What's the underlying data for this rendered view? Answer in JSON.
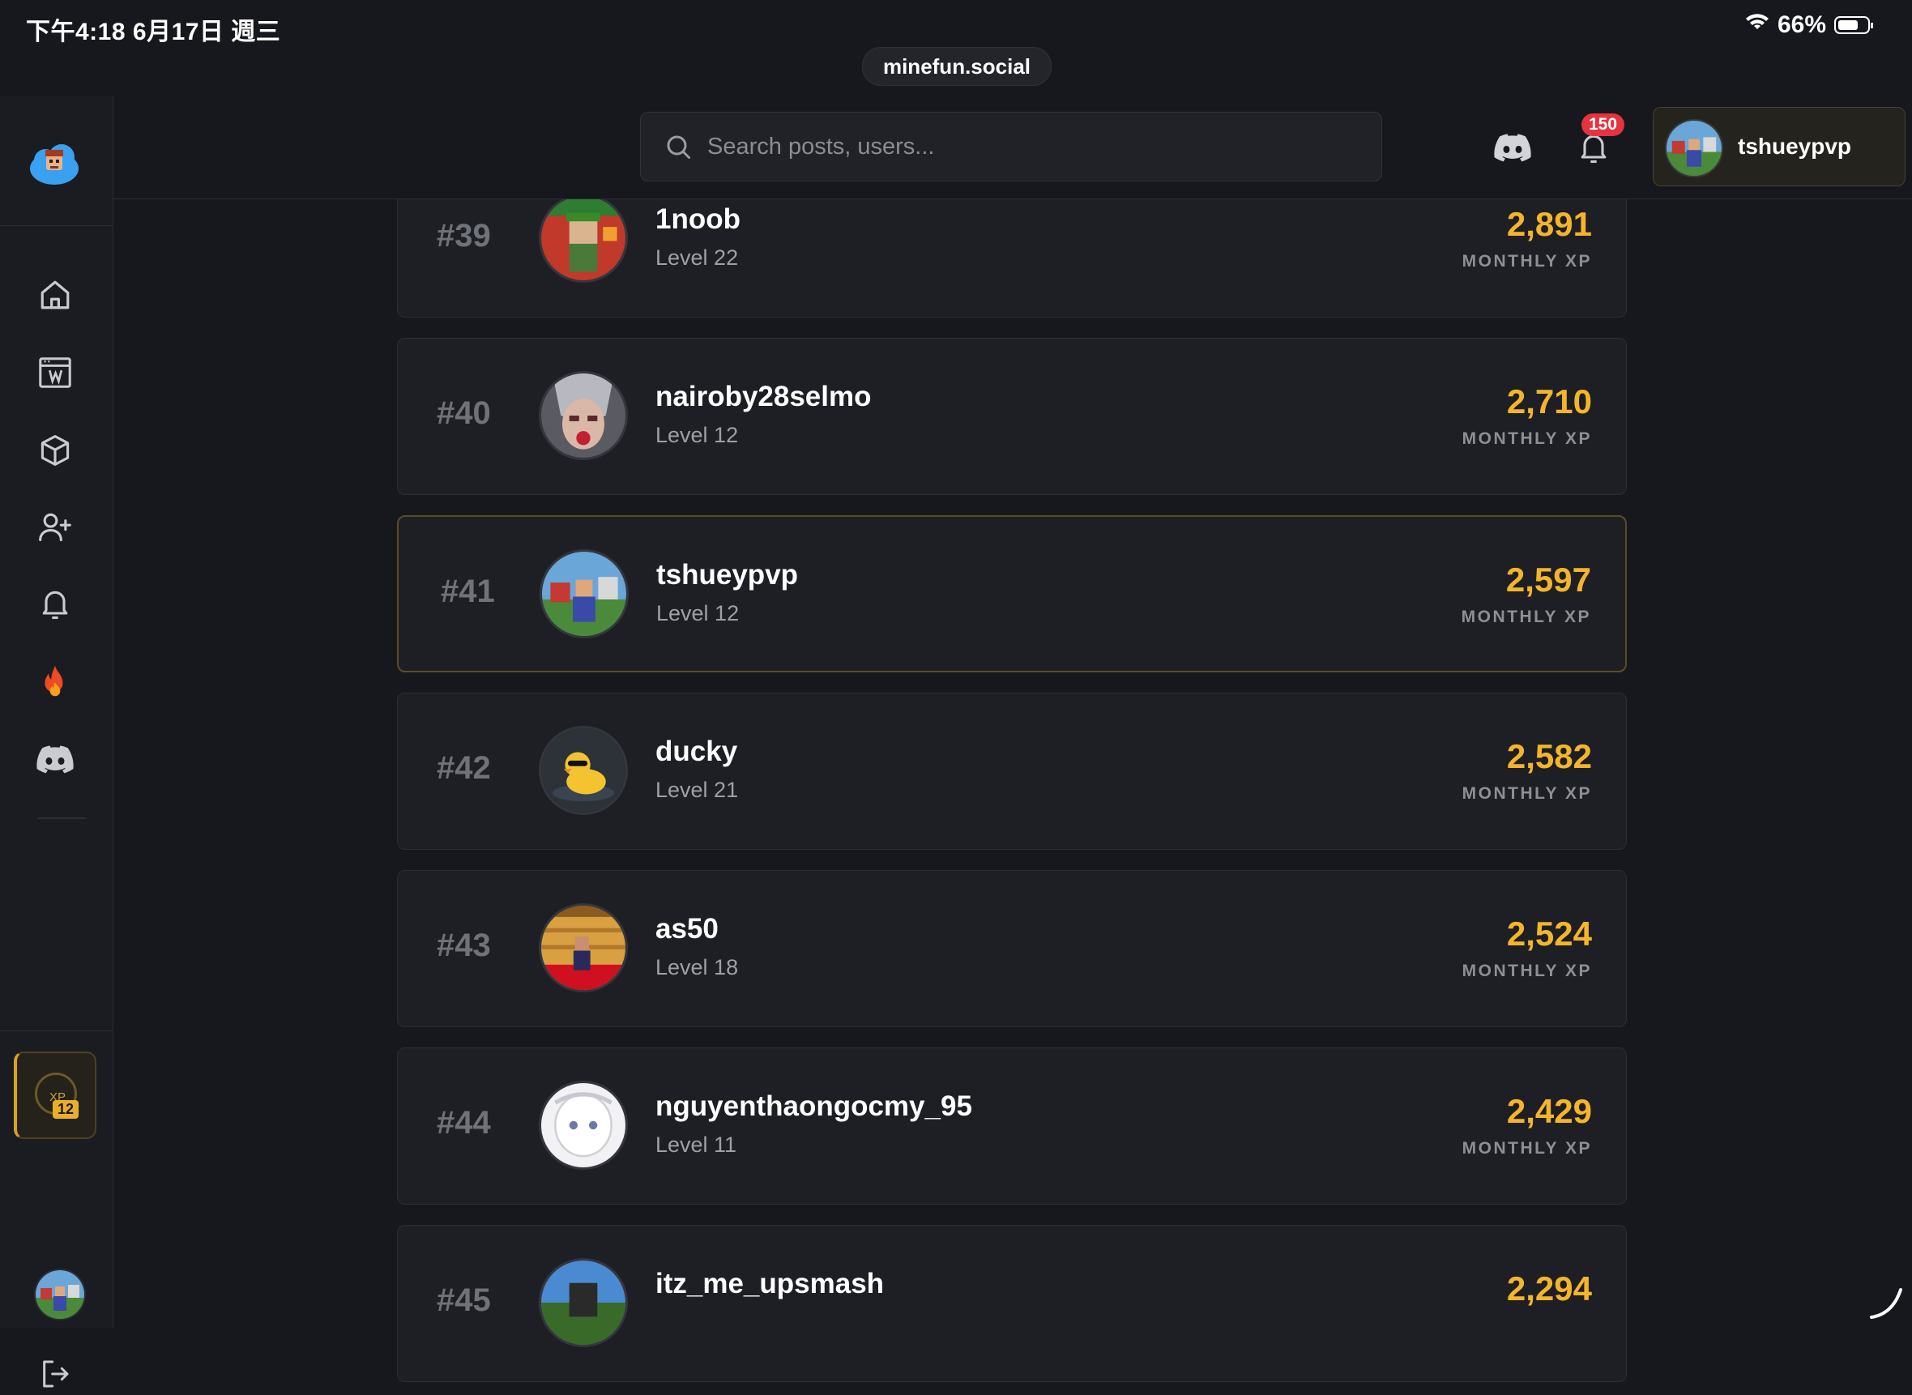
{
  "status_bar": {
    "time_date": "下午4:18   6月17日 週三",
    "battery": "66%"
  },
  "browser": {
    "url": "minefun.social"
  },
  "header": {
    "search_placeholder": "Search posts, users...",
    "notification_count": "150",
    "username": "tshueypvp"
  },
  "sidebar": {
    "items": [
      "home-icon",
      "wiki-icon",
      "cube-icon",
      "add-friend-icon",
      "bell-icon",
      "fire-icon",
      "discord-icon"
    ],
    "xp_label": "XP",
    "xp_level": "12"
  },
  "leaderboard": [
    {
      "rank": "#39",
      "name": "1noob",
      "level": "Level 22",
      "xp": "2,891",
      "xp_label": "MONTHLY XP"
    },
    {
      "rank": "#40",
      "name": "nairoby28selmo",
      "level": "Level 12",
      "xp": "2,710",
      "xp_label": "MONTHLY XP"
    },
    {
      "rank": "#41",
      "name": "tshueypvp",
      "level": "Level 12",
      "xp": "2,597",
      "xp_label": "MONTHLY XP"
    },
    {
      "rank": "#42",
      "name": "ducky",
      "level": "Level 21",
      "xp": "2,582",
      "xp_label": "MONTHLY XP"
    },
    {
      "rank": "#43",
      "name": "as50",
      "level": "Level 18",
      "xp": "2,524",
      "xp_label": "MONTHLY XP"
    },
    {
      "rank": "#44",
      "name": "nguyenthaongocmy_95",
      "level": "Level 11",
      "xp": "2,429",
      "xp_label": "MONTHLY XP"
    },
    {
      "rank": "#45",
      "name": "itz_me_upsmash",
      "level": "",
      "xp": "2,294",
      "xp_label": ""
    }
  ],
  "colors": {
    "background": "#17181d",
    "card": "#1e1f25",
    "accent_gold": "#f4b52a",
    "badge_red": "#e5343f"
  }
}
